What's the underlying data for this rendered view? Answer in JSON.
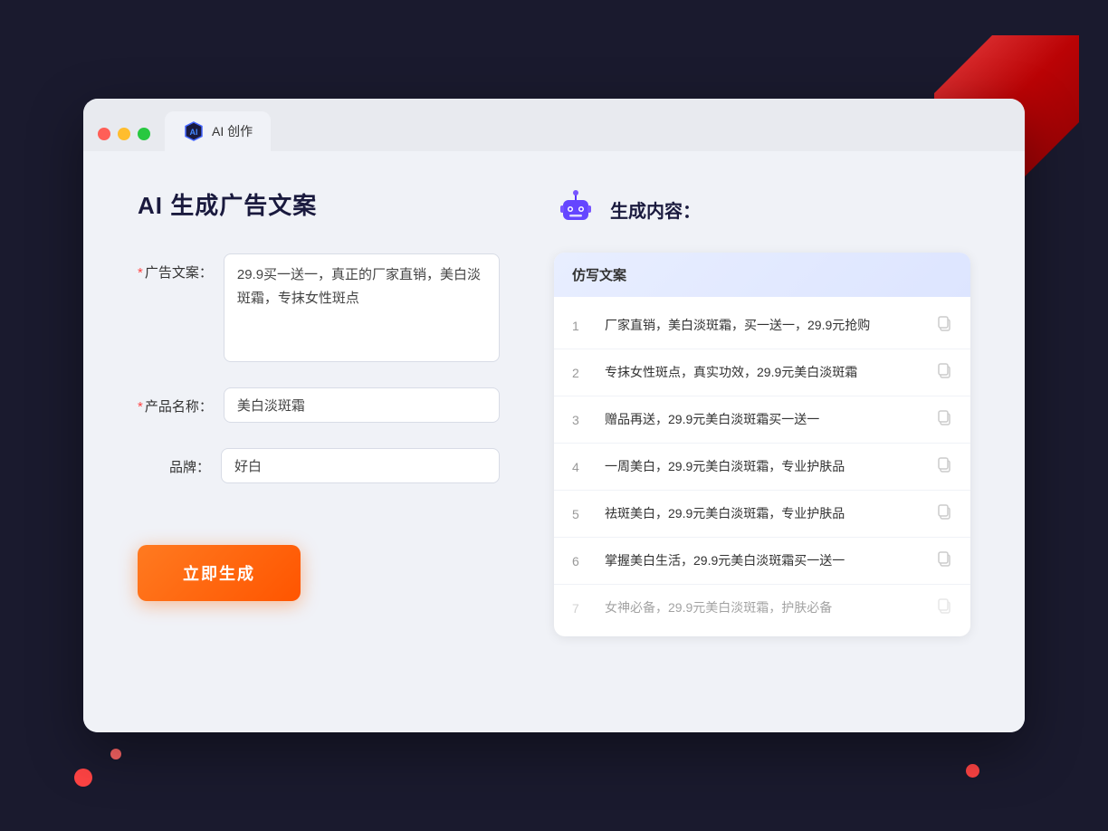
{
  "browser": {
    "tab_label": "AI 创作"
  },
  "page": {
    "title": "AI 生成广告文案",
    "result_title": "生成内容："
  },
  "form": {
    "ad_label": "广告文案：",
    "ad_required": "*",
    "ad_value": "29.9买一送一，真正的厂家直销，美白淡斑霜，专抹女性斑点",
    "product_label": "产品名称：",
    "product_required": "*",
    "product_value": "美白淡斑霜",
    "brand_label": "品牌：",
    "brand_value": "好白",
    "submit_label": "立即生成"
  },
  "results": {
    "column_header": "仿写文案",
    "items": [
      {
        "num": "1",
        "text": "厂家直销，美白淡斑霜，买一送一，29.9元抢购",
        "faded": false
      },
      {
        "num": "2",
        "text": "专抹女性斑点，真实功效，29.9元美白淡斑霜",
        "faded": false
      },
      {
        "num": "3",
        "text": "赠品再送，29.9元美白淡斑霜买一送一",
        "faded": false
      },
      {
        "num": "4",
        "text": "一周美白，29.9元美白淡斑霜，专业护肤品",
        "faded": false
      },
      {
        "num": "5",
        "text": "祛斑美白，29.9元美白淡斑霜，专业护肤品",
        "faded": false
      },
      {
        "num": "6",
        "text": "掌握美白生活，29.9元美白淡斑霜买一送一",
        "faded": false
      },
      {
        "num": "7",
        "text": "女神必备，29.9元美白淡斑霜，护肤必备",
        "faded": true
      }
    ]
  },
  "colors": {
    "accent_orange": "#ff6600",
    "accent_blue": "#4466ff",
    "star_red": "#ff4444"
  }
}
